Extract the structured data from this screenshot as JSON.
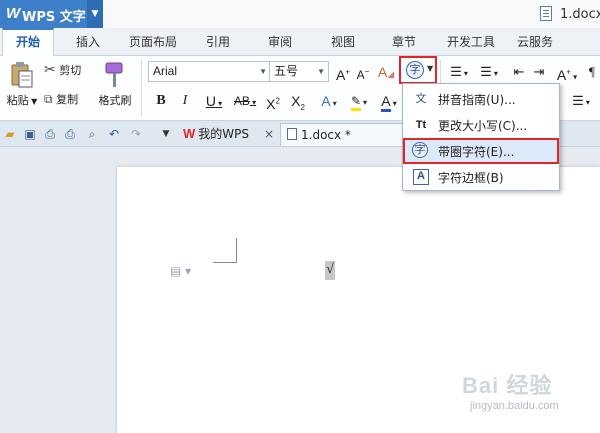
{
  "titlebar": {
    "app_name": "WPS 文字",
    "doc_name": "1.docx"
  },
  "ribbon_tabs": [
    {
      "label": "开始"
    },
    {
      "label": "插入"
    },
    {
      "label": "页面布局"
    },
    {
      "label": "引用"
    },
    {
      "label": "审阅"
    },
    {
      "label": "视图"
    },
    {
      "label": "章节"
    },
    {
      "label": "开发工具"
    },
    {
      "label": "云服务"
    }
  ],
  "ribbon": {
    "paste": "粘贴",
    "cut": "剪切",
    "copy": "复制",
    "format_painter": "格式刷",
    "font_name": "Arial",
    "font_size": "五号"
  },
  "doc_tabs": {
    "home": "我的WPS",
    "current": "1.docx *"
  },
  "menu": {
    "items": [
      {
        "label": "拼音指南(U)...",
        "icon": "pinyin-icon",
        "glyph": "文"
      },
      {
        "label": "更改大小写(C)...",
        "icon": "change-case-icon",
        "glyph": "Tt"
      },
      {
        "label": "带圈字符(E)...",
        "icon": "enclosed-char-icon",
        "glyph": "字"
      },
      {
        "label": "字符边框(B)",
        "icon": "char-border-icon",
        "glyph": "A"
      }
    ]
  },
  "document": {
    "content": "√"
  },
  "accent_color": "#3d7fc8",
  "highlight_color": "#e0252b",
  "watermark": {
    "main": "Bai 经验",
    "sub": "jingyan.baidu.com"
  }
}
